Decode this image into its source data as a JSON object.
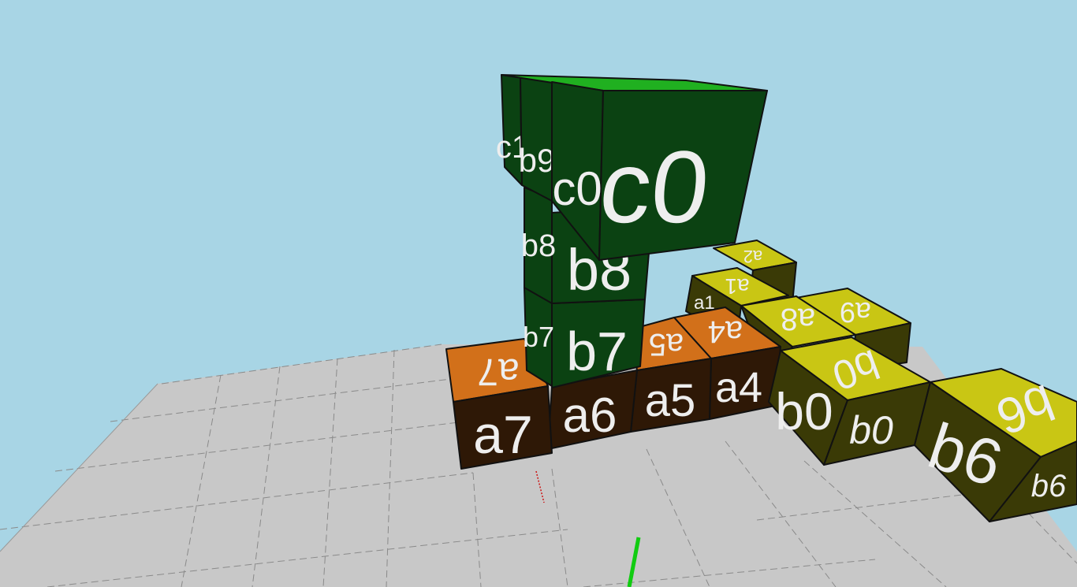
{
  "scene": {
    "background": "#a8d5e5",
    "floor_color": "#c8c8c8",
    "colors": {
      "green_face": "#0b4212",
      "green_top": "#20b020",
      "brown_front": "#2e1806",
      "orange_top": "#d2701a",
      "olive_front": "#3a3a06",
      "yellow_top": "#c9c614",
      "axis_green": "#11cc11",
      "axis_red": "#cc1111"
    },
    "blocks": {
      "c0": {
        "label": "c0"
      },
      "c0_side": {
        "label": "c0"
      },
      "b9": {
        "label": "b9"
      },
      "c1": {
        "label": "c1"
      },
      "b8_front": {
        "label": "b8"
      },
      "b8_side": {
        "label": "b8"
      },
      "b7_front": {
        "label": "b7"
      },
      "b7_side": {
        "label": "b7"
      },
      "a7_front": {
        "label": "a7"
      },
      "a7_top": {
        "label": "a7"
      },
      "a6_front": {
        "label": "a6"
      },
      "a5_front": {
        "label": "a5"
      },
      "a5_top": {
        "label": "a5"
      },
      "a4_front": {
        "label": "a4"
      },
      "a4_top": {
        "label": "a4"
      },
      "b0_front": {
        "label": "b0"
      },
      "b0_side": {
        "label": "b0"
      },
      "b0_top": {
        "label": "b0"
      },
      "b6_front": {
        "label": "b6"
      },
      "b6_side": {
        "label": "b6"
      },
      "b6_top": {
        "label": "b6"
      },
      "a9_top": {
        "label": "a9"
      },
      "a8_top": {
        "label": "a8"
      },
      "a1_top": {
        "label": "a1"
      },
      "a1_side": {
        "label": "a1"
      },
      "a2_top": {
        "label": "a2"
      }
    }
  }
}
